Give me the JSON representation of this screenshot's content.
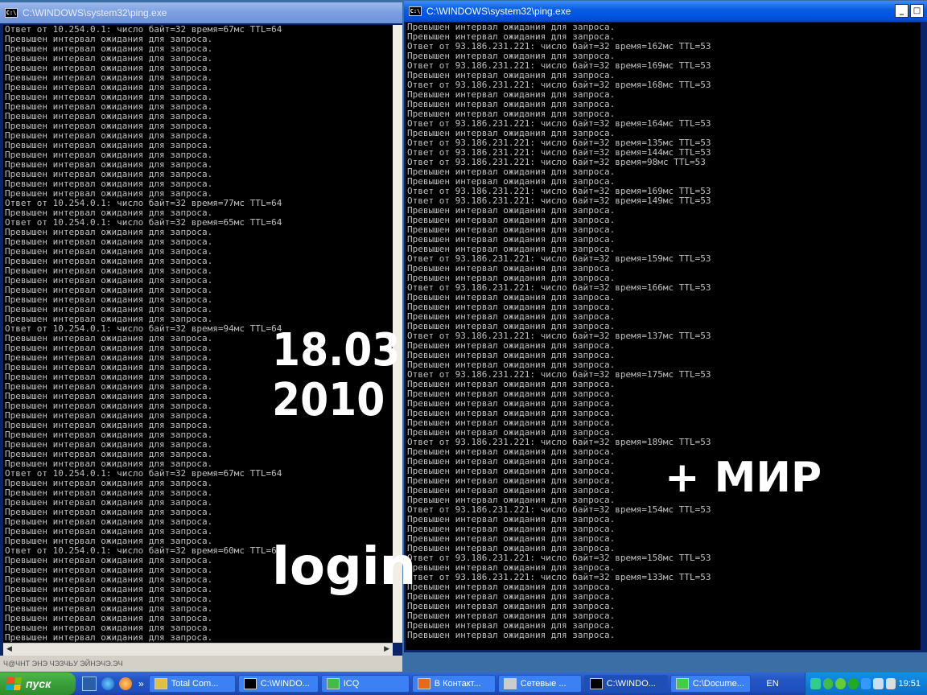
{
  "left_window": {
    "title": "C:\\WINDOWS\\system32\\ping.exe",
    "icon_label": "C:\\",
    "lines": [
      "Ответ от 10.254.0.1: число байт=32 время=67мс TTL=64",
      "Превышен интервал ожидания для запроса.",
      "Превышен интервал ожидания для запроса.",
      "Превышен интервал ожидания для запроса.",
      "Превышен интервал ожидания для запроса.",
      "Превышен интервал ожидания для запроса.",
      "Превышен интервал ожидания для запроса.",
      "Превышен интервал ожидания для запроса.",
      "Превышен интервал ожидания для запроса.",
      "Превышен интервал ожидания для запроса.",
      "Превышен интервал ожидания для запроса.",
      "Превышен интервал ожидания для запроса.",
      "Превышен интервал ожидания для запроса.",
      "Превышен интервал ожидания для запроса.",
      "Превышен интервал ожидания для запроса.",
      "Превышен интервал ожидания для запроса.",
      "Превышен интервал ожидания для запроса.",
      "Превышен интервал ожидания для запроса.",
      "Ответ от 10.254.0.1: число байт=32 время=77мс TTL=64",
      "Превышен интервал ожидания для запроса.",
      "Ответ от 10.254.0.1: число байт=32 время=65мс TTL=64",
      "Превышен интервал ожидания для запроса.",
      "Превышен интервал ожидания для запроса.",
      "Превышен интервал ожидания для запроса.",
      "Превышен интервал ожидания для запроса.",
      "Превышен интервал ожидания для запроса.",
      "Превышен интервал ожидания для запроса.",
      "Превышен интервал ожидания для запроса.",
      "Превышен интервал ожидания для запроса.",
      "Превышен интервал ожидания для запроса.",
      "Превышен интервал ожидания для запроса.",
      "Ответ от 10.254.0.1: число байт=32 время=94мс TTL=64",
      "Превышен интервал ожидания для запроса.",
      "Превышен интервал ожидания для запроса.",
      "Превышен интервал ожидания для запроса.",
      "Превышен интервал ожидания для запроса.",
      "Превышен интервал ожидания для запроса.",
      "Превышен интервал ожидания для запроса.",
      "Превышен интервал ожидания для запроса.",
      "Превышен интервал ожидания для запроса.",
      "Превышен интервал ожидания для запроса.",
      "Превышен интервал ожидания для запроса.",
      "Превышен интервал ожидания для запроса.",
      "Превышен интервал ожидания для запроса.",
      "Превышен интервал ожидания для запроса.",
      "Превышен интервал ожидания для запроса.",
      "Ответ от 10.254.0.1: число байт=32 время=67мс TTL=64",
      "Превышен интервал ожидания для запроса.",
      "Превышен интервал ожидания для запроса.",
      "Превышен интервал ожидания для запроса.",
      "Превышен интервал ожидания для запроса.",
      "Превышен интервал ожидания для запроса.",
      "Превышен интервал ожидания для запроса.",
      "Превышен интервал ожидания для запроса.",
      "Ответ от 10.254.0.1: число байт=32 время=60мс TTL=64",
      "Превышен интервал ожидания для запроса.",
      "Превышен интервал ожидания для запроса.",
      "Превышен интервал ожидания для запроса.",
      "Превышен интервал ожидания для запроса.",
      "Превышен интервал ожидания для запроса.",
      "Превышен интервал ожидания для запроса.",
      "Превышен интервал ожидания для запроса.",
      "Превышен интервал ожидания для запроса.",
      "Превышен интервал ожидания для запроса.",
      "Превышен интервал ожидания для запроса.",
      "Превышен интервал ожидания для запроса."
    ]
  },
  "right_window": {
    "title": "C:\\WINDOWS\\system32\\ping.exe",
    "icon_label": "C:\\",
    "lines": [
      "Превышен интервал ожидания для запроса.",
      "Превышен интервал ожидания для запроса.",
      "Ответ от 93.186.231.221: число байт=32 время=162мс TTL=53",
      "Превышен интервал ожидания для запроса.",
      "Ответ от 93.186.231.221: число байт=32 время=169мс TTL=53",
      "Превышен интервал ожидания для запроса.",
      "Ответ от 93.186.231.221: число байт=32 время=168мс TTL=53",
      "Превышен интервал ожидания для запроса.",
      "Превышен интервал ожидания для запроса.",
      "Превышен интервал ожидания для запроса.",
      "Ответ от 93.186.231.221: число байт=32 время=164мс TTL=53",
      "Превышен интервал ожидания для запроса.",
      "Ответ от 93.186.231.221: число байт=32 время=135мс TTL=53",
      "Ответ от 93.186.231.221: число байт=32 время=144мс TTL=53",
      "Ответ от 93.186.231.221: число байт=32 время=98мс TTL=53",
      "Превышен интервал ожидания для запроса.",
      "Превышен интервал ожидания для запроса.",
      "Ответ от 93.186.231.221: число байт=32 время=169мс TTL=53",
      "Ответ от 93.186.231.221: число байт=32 время=149мс TTL=53",
      "Превышен интервал ожидания для запроса.",
      "Превышен интервал ожидания для запроса.",
      "Превышен интервал ожидания для запроса.",
      "Превышен интервал ожидания для запроса.",
      "Превышен интервал ожидания для запроса.",
      "Ответ от 93.186.231.221: число байт=32 время=159мс TTL=53",
      "Превышен интервал ожидания для запроса.",
      "Превышен интервал ожидания для запроса.",
      "Ответ от 93.186.231.221: число байт=32 время=166мс TTL=53",
      "Превышен интервал ожидания для запроса.",
      "Превышен интервал ожидания для запроса.",
      "Превышен интервал ожидания для запроса.",
      "Превышен интервал ожидания для запроса.",
      "Ответ от 93.186.231.221: число байт=32 время=137мс TTL=53",
      "Превышен интервал ожидания для запроса.",
      "Превышен интервал ожидания для запроса.",
      "Превышен интервал ожидания для запроса.",
      "Ответ от 93.186.231.221: число байт=32 время=175мс TTL=53",
      "Превышен интервал ожидания для запроса.",
      "Превышен интервал ожидания для запроса.",
      "Превышен интервал ожидания для запроса.",
      "Превышен интервал ожидания для запроса.",
      "Превышен интервал ожидания для запроса.",
      "Превышен интервал ожидания для запроса.",
      "Ответ от 93.186.231.221: число байт=32 время=189мс TTL=53",
      "Превышен интервал ожидания для запроса.",
      "Превышен интервал ожидания для запроса.",
      "Превышен интервал ожидания для запроса.",
      "Превышен интервал ожидания для запроса.",
      "Превышен интервал ожидания для запроса.",
      "Превышен интервал ожидания для запроса.",
      "Ответ от 93.186.231.221: число байт=32 время=154мс TTL=53",
      "Превышен интервал ожидания для запроса.",
      "Превышен интервал ожидания для запроса.",
      "Превышен интервал ожидания для запроса.",
      "Превышен интервал ожидания для запроса.",
      "Ответ от 93.186.231.221: число байт=32 время=158мс TTL=53",
      "Превышен интервал ожидания для запроса.",
      "Ответ от 93.186.231.221: число байт=32 время=133мс TTL=53",
      "Превышен интервал ожидания для запроса.",
      "Превышен интервал ожидания для запроса.",
      "Превышен интервал ожидания для запроса.",
      "Превышен интервал ожидания для запроса.",
      "Превышен интервал ожидания для запроса.",
      "Превышен интервал ожидания для запроса."
    ]
  },
  "annotations": {
    "date_line1": "18.03",
    "date_line2": "2010",
    "login": "login",
    "mir": "+ МИР"
  },
  "taskbar": {
    "start_label": "пуск",
    "tasks": [
      {
        "label": "Total Com...",
        "icon": "total-commander-icon",
        "color": "#e0c040"
      },
      {
        "label": "C:\\WINDO...",
        "icon": "console-icon",
        "color": "#000000"
      },
      {
        "label": "ICQ",
        "icon": "icq-flower-icon",
        "color": "#44bb44"
      },
      {
        "label": "В Контакт...",
        "icon": "firefox-icon",
        "color": "#e66a1a"
      },
      {
        "label": "Сетевые ...",
        "icon": "network-icon",
        "color": "#cccccc"
      },
      {
        "label": "C:\\WINDO...",
        "icon": "console-icon",
        "color": "#000000"
      },
      {
        "label": "C:\\Docume...",
        "icon": "arrow-icon",
        "color": "#44cc44"
      }
    ],
    "lang": "EN",
    "clock": "19:51"
  },
  "status_text": "Ч@ЧНТ ЭНЭ ЧЭЗЧЬУ ЭЙНЭЧЭ.ЭЧ"
}
